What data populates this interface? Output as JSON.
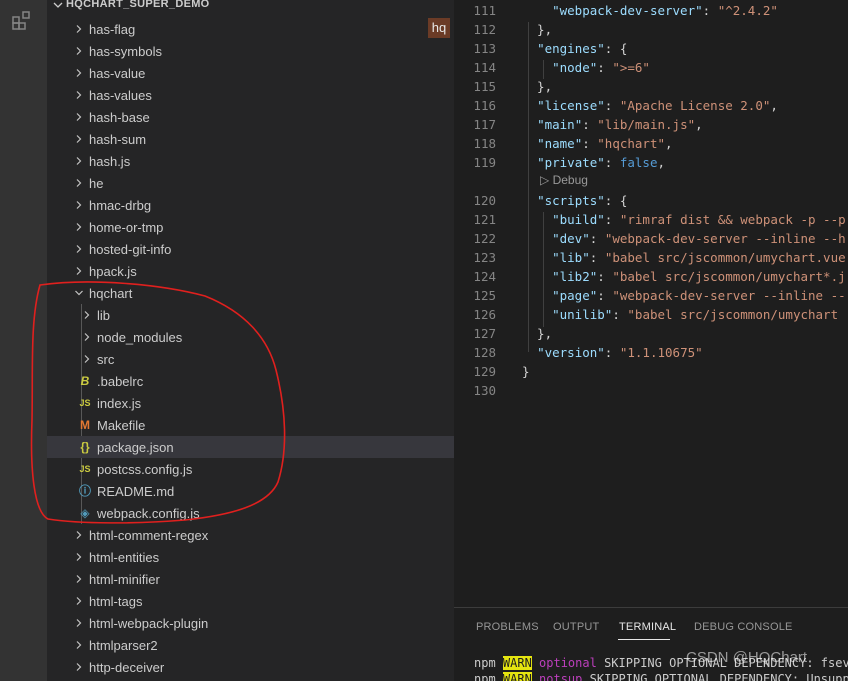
{
  "explorer": {
    "section_title": "HQCHART_SUPER_DEMO",
    "badge": "hq",
    "items": [
      {
        "label": "has-flag",
        "type": "folder",
        "level": 0,
        "expanded": false
      },
      {
        "label": "has-symbols",
        "type": "folder",
        "level": 0,
        "expanded": false
      },
      {
        "label": "has-value",
        "type": "folder",
        "level": 0,
        "expanded": false
      },
      {
        "label": "has-values",
        "type": "folder",
        "level": 0,
        "expanded": false
      },
      {
        "label": "hash-base",
        "type": "folder",
        "level": 0,
        "expanded": false
      },
      {
        "label": "hash-sum",
        "type": "folder",
        "level": 0,
        "expanded": false
      },
      {
        "label": "hash.js",
        "type": "folder",
        "level": 0,
        "expanded": false
      },
      {
        "label": "he",
        "type": "folder",
        "level": 0,
        "expanded": false
      },
      {
        "label": "hmac-drbg",
        "type": "folder",
        "level": 0,
        "expanded": false
      },
      {
        "label": "home-or-tmp",
        "type": "folder",
        "level": 0,
        "expanded": false
      },
      {
        "label": "hosted-git-info",
        "type": "folder",
        "level": 0,
        "expanded": false
      },
      {
        "label": "hpack.js",
        "type": "folder",
        "level": 0,
        "expanded": false
      },
      {
        "label": "hqchart",
        "type": "folder",
        "level": 0,
        "expanded": true
      },
      {
        "label": "lib",
        "type": "folder",
        "level": 1,
        "expanded": false
      },
      {
        "label": "node_modules",
        "type": "folder",
        "level": 1,
        "expanded": false
      },
      {
        "label": "src",
        "type": "folder",
        "level": 1,
        "expanded": false
      },
      {
        "label": ".babelrc",
        "type": "babel",
        "level": 1
      },
      {
        "label": "index.js",
        "type": "js",
        "level": 1
      },
      {
        "label": "Makefile",
        "type": "make",
        "level": 1
      },
      {
        "label": "package.json",
        "type": "json",
        "level": 1,
        "selected": true
      },
      {
        "label": "postcss.config.js",
        "type": "js",
        "level": 1
      },
      {
        "label": "README.md",
        "type": "info",
        "level": 1
      },
      {
        "label": "webpack.config.js",
        "type": "webpack",
        "level": 1
      },
      {
        "label": "html-comment-regex",
        "type": "folder",
        "level": 0,
        "expanded": false
      },
      {
        "label": "html-entities",
        "type": "folder",
        "level": 0,
        "expanded": false
      },
      {
        "label": "html-minifier",
        "type": "folder",
        "level": 0,
        "expanded": false
      },
      {
        "label": "html-tags",
        "type": "folder",
        "level": 0,
        "expanded": false
      },
      {
        "label": "html-webpack-plugin",
        "type": "folder",
        "level": 0,
        "expanded": false
      },
      {
        "label": "htmlparser2",
        "type": "folder",
        "level": 0,
        "expanded": false
      },
      {
        "label": "http-deceiver",
        "type": "folder",
        "level": 0,
        "expanded": false
      }
    ]
  },
  "editor": {
    "codelens": "Debug",
    "lines": [
      {
        "num": "111",
        "tokens": [
          [
            "p",
            "    "
          ],
          [
            "k",
            "\"webpack-dev-server\""
          ],
          [
            "p",
            ": "
          ],
          [
            "s",
            "\"^2.4.2\""
          ]
        ]
      },
      {
        "num": "112",
        "tokens": [
          [
            "p",
            "  },"
          ]
        ]
      },
      {
        "num": "113",
        "tokens": [
          [
            "p",
            "  "
          ],
          [
            "k",
            "\"engines\""
          ],
          [
            "p",
            ": {"
          ]
        ]
      },
      {
        "num": "114",
        "tokens": [
          [
            "p",
            "    "
          ],
          [
            "k",
            "\"node\""
          ],
          [
            "p",
            ": "
          ],
          [
            "s",
            "\">=6\""
          ]
        ]
      },
      {
        "num": "115",
        "tokens": [
          [
            "p",
            "  },"
          ]
        ]
      },
      {
        "num": "116",
        "tokens": [
          [
            "p",
            "  "
          ],
          [
            "k",
            "\"license\""
          ],
          [
            "p",
            ": "
          ],
          [
            "s",
            "\"Apache License 2.0\""
          ],
          [
            "p",
            ","
          ]
        ]
      },
      {
        "num": "117",
        "tokens": [
          [
            "p",
            "  "
          ],
          [
            "k",
            "\"main\""
          ],
          [
            "p",
            ": "
          ],
          [
            "s",
            "\"lib/main.js\""
          ],
          [
            "p",
            ","
          ]
        ]
      },
      {
        "num": "118",
        "tokens": [
          [
            "p",
            "  "
          ],
          [
            "k",
            "\"name\""
          ],
          [
            "p",
            ": "
          ],
          [
            "s",
            "\"hqchart\""
          ],
          [
            "p",
            ","
          ]
        ]
      },
      {
        "num": "119",
        "tokens": [
          [
            "p",
            "  "
          ],
          [
            "k",
            "\"private\""
          ],
          [
            "p",
            ": "
          ],
          [
            "b",
            "false"
          ],
          [
            "p",
            ","
          ]
        ]
      },
      {
        "num": "120",
        "tokens": [
          [
            "p",
            "  "
          ],
          [
            "k",
            "\"scripts\""
          ],
          [
            "p",
            ": {"
          ]
        ]
      },
      {
        "num": "121",
        "tokens": [
          [
            "p",
            "    "
          ],
          [
            "k",
            "\"build\""
          ],
          [
            "p",
            ": "
          ],
          [
            "s",
            "\"rimraf dist && webpack -p --p"
          ]
        ]
      },
      {
        "num": "122",
        "tokens": [
          [
            "p",
            "    "
          ],
          [
            "k",
            "\"dev\""
          ],
          [
            "p",
            ": "
          ],
          [
            "s",
            "\"webpack-dev-server --inline --h"
          ]
        ]
      },
      {
        "num": "123",
        "tokens": [
          [
            "p",
            "    "
          ],
          [
            "k",
            "\"lib\""
          ],
          [
            "p",
            ": "
          ],
          [
            "s",
            "\"babel src/jscommon/umychart.vue"
          ]
        ]
      },
      {
        "num": "124",
        "tokens": [
          [
            "p",
            "    "
          ],
          [
            "k",
            "\"lib2\""
          ],
          [
            "p",
            ": "
          ],
          [
            "s",
            "\"babel src/jscommon/umychart*.j"
          ]
        ]
      },
      {
        "num": "125",
        "tokens": [
          [
            "p",
            "    "
          ],
          [
            "k",
            "\"page\""
          ],
          [
            "p",
            ": "
          ],
          [
            "s",
            "\"webpack-dev-server --inline --"
          ]
        ]
      },
      {
        "num": "126",
        "tokens": [
          [
            "p",
            "    "
          ],
          [
            "k",
            "\"unilib\""
          ],
          [
            "p",
            ": "
          ],
          [
            "s",
            "\"babel src/jscommon/umychart"
          ]
        ]
      },
      {
        "num": "127",
        "tokens": [
          [
            "p",
            "  },"
          ]
        ]
      },
      {
        "num": "128",
        "tokens": [
          [
            "p",
            "  "
          ],
          [
            "k",
            "\"version\""
          ],
          [
            "p",
            ": "
          ],
          [
            "s",
            "\"1.1.10675\""
          ]
        ]
      },
      {
        "num": "129",
        "tokens": [
          [
            "p",
            "}"
          ]
        ]
      },
      {
        "num": "130",
        "tokens": []
      }
    ]
  },
  "panel": {
    "tabs": [
      "PROBLEMS",
      "OUTPUT",
      "TERMINAL",
      "DEBUG CONSOLE"
    ],
    "active_tab": "TERMINAL",
    "terminal_lines": [
      {
        "prefix": "npm ",
        "level": "WARN",
        "kind": "optional",
        "rest": " SKIPPING OPTIONAL DEPENDENCY: fsever"
      },
      {
        "prefix": "npm ",
        "level": "WARN",
        "kind": "notsup",
        "rest": " SKIPPING OPTIONAL DEPENDENCY: Unsuppor"
      }
    ],
    "watermark": "CSDN @HQChart"
  },
  "colors": {
    "annotation": "#e0201e",
    "json_icon": "#cbcb41",
    "js_icon": "#cbcb41",
    "make_icon": "#e37933",
    "info_icon": "#519aba",
    "webpack_icon": "#519aba",
    "babel_icon": "#cbcb41"
  }
}
